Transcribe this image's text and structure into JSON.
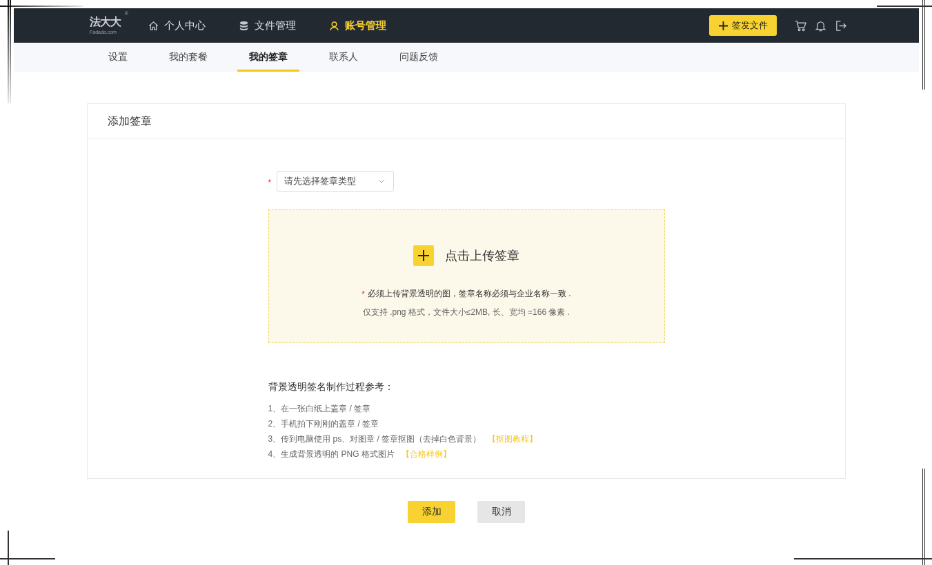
{
  "header": {
    "logo": {
      "name": "法大大",
      "domain": "Fadada.com",
      "registered": "®"
    },
    "nav": [
      {
        "label": "个人中心",
        "selected": false
      },
      {
        "label": "文件管理",
        "selected": false
      },
      {
        "label": "账号管理",
        "selected": true
      }
    ],
    "action_button": {
      "label": "签发文件"
    }
  },
  "tabs": [
    {
      "label": "设置",
      "selected": false
    },
    {
      "label": "我的套餐",
      "selected": false
    },
    {
      "label": "我的签章",
      "selected": true
    },
    {
      "label": "联系人",
      "selected": false
    },
    {
      "label": "问题反馈",
      "selected": false
    }
  ],
  "card": {
    "title": "添加签章",
    "select": {
      "required_mark": "*",
      "placeholder": "请先选择签章类型"
    },
    "upload": {
      "label": "点击上传签章",
      "notes": [
        {
          "mark": "*",
          "text": "必须上传背景透明的图，签章名称必须与企业名称一致 ."
        },
        {
          "text": "仅支持 .png 格式，文件大小≤2MB, 长、宽均 =166 像素 ."
        }
      ]
    },
    "guide": {
      "title": "背景透明签名制作过程参考：",
      "steps": [
        {
          "text": "1、在一张白纸上盖章 / 签章"
        },
        {
          "text": "2、手机拍下刚刚的盖章 / 签章"
        },
        {
          "text": "3、传到电脑使用 ps、对图章 / 签章抠图（去掉白色背景）",
          "link": "【抠图教程】"
        },
        {
          "text": "4、生成背景透明的 PNG 格式图片",
          "link": "【合格样例】"
        }
      ]
    }
  },
  "buttons": [
    {
      "label": "添加",
      "kind": "primary"
    },
    {
      "label": "取消",
      "kind": "secondary"
    }
  ]
}
